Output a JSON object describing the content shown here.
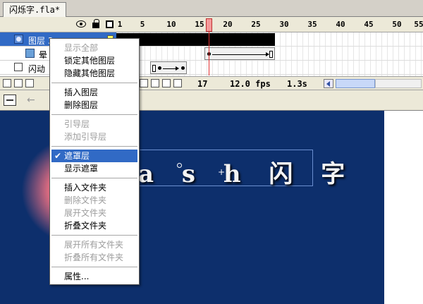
{
  "document": {
    "tab_title": "闪烁字.fla*"
  },
  "timeline": {
    "ruler_numbers": [
      "1",
      "5",
      "10",
      "15",
      "20",
      "25",
      "30",
      "35",
      "40",
      "45",
      "50",
      "55"
    ],
    "layers": [
      {
        "name": "图层 3",
        "type": "mask",
        "selected": true
      },
      {
        "name": "晕",
        "type": "masked",
        "selected": false
      },
      {
        "name": "闪动",
        "type": "normal",
        "selected": false
      }
    ],
    "footer": {
      "current_frame": "17",
      "frame_rate": "12.0 fps",
      "elapsed_time": "1.3s"
    }
  },
  "stage": {
    "text": "a s h 闪 字",
    "background_color": "#0d2f6c"
  },
  "context_menu": {
    "groups": [
      [
        {
          "label": "显示全部",
          "enabled": false
        },
        {
          "label": "锁定其他图层",
          "enabled": true
        },
        {
          "label": "隐藏其他图层",
          "enabled": true
        }
      ],
      [
        {
          "label": "插入图层",
          "enabled": true
        },
        {
          "label": "删除图层",
          "enabled": true
        }
      ],
      [
        {
          "label": "引导层",
          "enabled": false
        },
        {
          "label": "添加引导层",
          "enabled": false
        }
      ],
      [
        {
          "label": "遮罩层",
          "enabled": true,
          "checked": true,
          "highlighted": true
        },
        {
          "label": "显示遮罩",
          "enabled": true
        }
      ],
      [
        {
          "label": "插入文件夹",
          "enabled": true
        },
        {
          "label": "删除文件夹",
          "enabled": false
        },
        {
          "label": "展开文件夹",
          "enabled": false
        },
        {
          "label": "折叠文件夹",
          "enabled": true
        }
      ],
      [
        {
          "label": "展开所有文件夹",
          "enabled": false
        },
        {
          "label": "折叠所有文件夹",
          "enabled": false
        }
      ],
      [
        {
          "label": "属性...",
          "enabled": true
        }
      ]
    ]
  },
  "colors": {
    "selection": "#316ac5",
    "stage_background": "#0d2f6c",
    "playhead": "#e03030"
  }
}
